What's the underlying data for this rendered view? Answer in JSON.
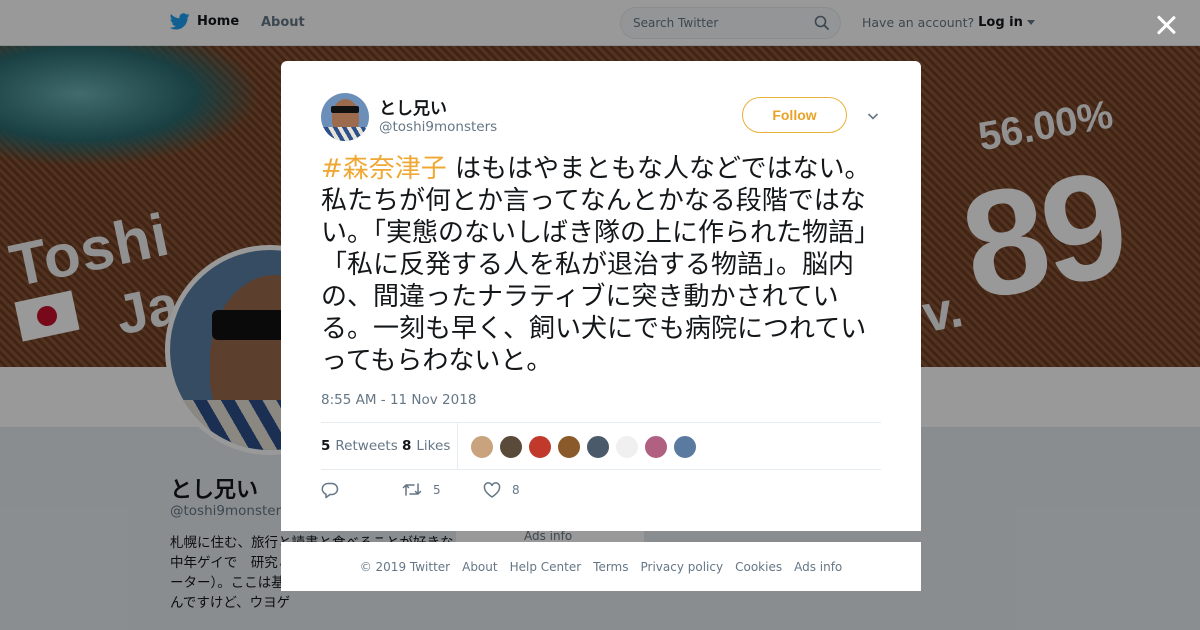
{
  "nav": {
    "home_label": "Home",
    "about_label": "About"
  },
  "search": {
    "placeholder": "Search Twitter"
  },
  "account": {
    "prompt": "Have an account?",
    "login_label": "Log in"
  },
  "banner": {
    "line1": "Toshi",
    "line2": "Ja",
    "percent": "56.00%",
    "number": "89",
    "v": "v."
  },
  "profile": {
    "name": "とし兄い",
    "handle": "@toshi9monsters",
    "bio": "札幌に住む、旅行と読書と食べることが好きな中年ゲイで　研究と実践をして　講師、キュレーター）。ここは基本ゲイの友人アカウントなんですけど、ウヨゲ",
    "ads_info": "Ads info"
  },
  "tweet": {
    "author_name": "とし兄い",
    "author_handle": "@toshi9monsters",
    "follow_label": "Follow",
    "hashtag": "#森奈津子",
    "text": " はもはやまともな人などではない。私たちが何とか言ってなんとかなる段階ではない。「実態のないしばき隊の上に作られた物語」「私に反発する人を私が退治する物語」。脳内の、間違ったナラティブに突き動かされている。一刻も早く、飼い犬にでも病院につれていってもらわないと。",
    "timestamp": "8:55 AM - 11 Nov 2018",
    "retweet_count": "5",
    "retweet_label": "Retweets",
    "like_count": "8",
    "like_label": "Likes",
    "action_retweet_count": "5",
    "action_like_count": "8"
  },
  "likers": [
    {
      "color": "#c9a27e"
    },
    {
      "color": "#5a4a3a"
    },
    {
      "color": "#c0392b"
    },
    {
      "color": "#8a5a2b"
    },
    {
      "color": "#4a5a6a"
    },
    {
      "color": "#f0f0f0"
    },
    {
      "color": "#b06080"
    },
    {
      "color": "#5a7aa0"
    }
  ],
  "footer": {
    "copyright": "© 2019 Twitter",
    "about": "About",
    "help": "Help Center",
    "terms": "Terms",
    "privacy": "Privacy policy",
    "cookies": "Cookies",
    "ads": "Ads info"
  },
  "colors": {
    "twitter_blue": "#1da1f2",
    "hashtag": "#f0a834",
    "follow": "#e8a326"
  }
}
